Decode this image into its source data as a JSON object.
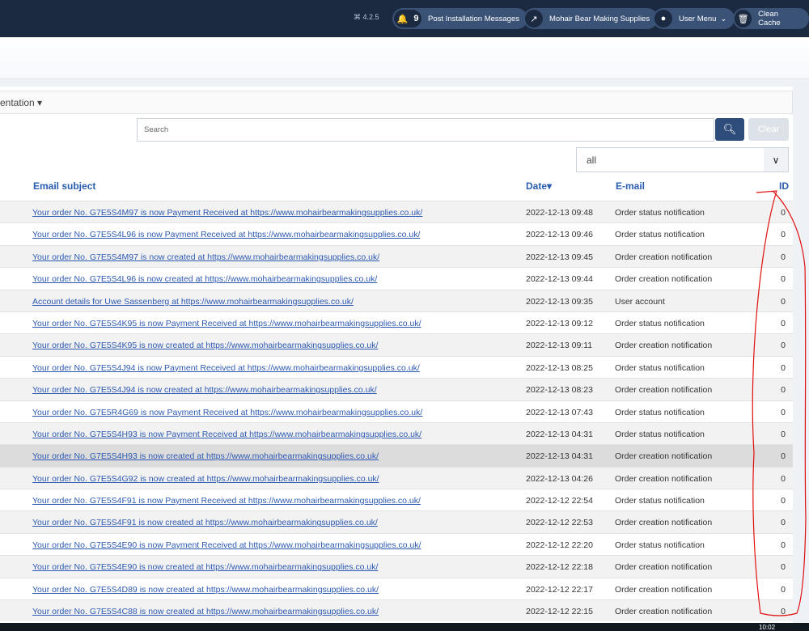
{
  "header": {
    "version": "4.2.5",
    "notifications_count": "9",
    "post_install": "Post Installation Messages",
    "site": "Mohair Bear Making Supplies",
    "user_menu": "User Menu",
    "clean_cache": "Clean Cache"
  },
  "toolbar": {
    "partial_label": "entation ▾"
  },
  "search": {
    "placeholder": "Search",
    "clear": "Clear"
  },
  "filter": {
    "value": "all"
  },
  "table": {
    "columns": {
      "subject": "Email subject",
      "date": "Date▾",
      "email": "E-mail",
      "id": "ID"
    },
    "rows": [
      {
        "subject": "Your order No. G7E5S4M97 is now Payment Received at https://www.mohairbearmakingsupplies.co.uk/",
        "date": "2022-12-13 09:48",
        "email": "Order status notification",
        "id": "0"
      },
      {
        "subject": "Your order No. G7E5S4L96 is now Payment Received at https://www.mohairbearmakingsupplies.co.uk/",
        "date": "2022-12-13 09:46",
        "email": "Order status notification",
        "id": "0"
      },
      {
        "subject": "Your order No. G7E5S4M97 is now created at https://www.mohairbearmakingsupplies.co.uk/",
        "date": "2022-12-13 09:45",
        "email": "Order creation notification",
        "id": "0"
      },
      {
        "subject": "Your order No. G7E5S4L96 is now created at https://www.mohairbearmakingsupplies.co.uk/",
        "date": "2022-12-13 09:44",
        "email": "Order creation notification",
        "id": "0"
      },
      {
        "subject": "Account details for Uwe Sassenberg at https://www.mohairbearmakingsupplies.co.uk/",
        "date": "2022-12-13 09:35",
        "email": "User account",
        "id": "0"
      },
      {
        "subject": "Your order No. G7E5S4K95 is now Payment Received at https://www.mohairbearmakingsupplies.co.uk/",
        "date": "2022-12-13 09:12",
        "email": "Order status notification",
        "id": "0"
      },
      {
        "subject": "Your order No. G7E5S4K95 is now created at https://www.mohairbearmakingsupplies.co.uk/",
        "date": "2022-12-13 09:11",
        "email": "Order creation notification",
        "id": "0"
      },
      {
        "subject": "Your order No. G7E5S4J94 is now Payment Received at https://www.mohairbearmakingsupplies.co.uk/",
        "date": "2022-12-13 08:25",
        "email": "Order status notification",
        "id": "0"
      },
      {
        "subject": "Your order No. G7E5S4J94 is now created at https://www.mohairbearmakingsupplies.co.uk/",
        "date": "2022-12-13 08:23",
        "email": "Order creation notification",
        "id": "0"
      },
      {
        "subject": "Your order No. G7E5R4G69 is now Payment Received at https://www.mohairbearmakingsupplies.co.uk/",
        "date": "2022-12-13 07:43",
        "email": "Order status notification",
        "id": "0"
      },
      {
        "subject": "Your order No. G7E5S4H93 is now Payment Received at https://www.mohairbearmakingsupplies.co.uk/",
        "date": "2022-12-13 04:31",
        "email": "Order status notification",
        "id": "0"
      },
      {
        "subject": "Your order No. G7E5S4H93 is now created at https://www.mohairbearmakingsupplies.co.uk/",
        "date": "2022-12-13 04:31",
        "email": "Order creation notification",
        "id": "0"
      },
      {
        "subject": "Your order No. G7E5S4G92 is now created at https://www.mohairbearmakingsupplies.co.uk/",
        "date": "2022-12-13 04:26",
        "email": "Order creation notification",
        "id": "0"
      },
      {
        "subject": "Your order No. G7E5S4F91 is now Payment Received at https://www.mohairbearmakingsupplies.co.uk/",
        "date": "2022-12-12 22:54",
        "email": "Order status notification",
        "id": "0"
      },
      {
        "subject": "Your order No. G7E5S4F91 is now created at https://www.mohairbearmakingsupplies.co.uk/",
        "date": "2022-12-12 22:53",
        "email": "Order creation notification",
        "id": "0"
      },
      {
        "subject": "Your order No. G7E5S4E90 is now Payment Received at https://www.mohairbearmakingsupplies.co.uk/",
        "date": "2022-12-12 22:20",
        "email": "Order status notification",
        "id": "0"
      },
      {
        "subject": "Your order No. G7E5S4E90 is now created at https://www.mohairbearmakingsupplies.co.uk/",
        "date": "2022-12-12 22:18",
        "email": "Order creation notification",
        "id": "0"
      },
      {
        "subject": "Your order No. G7E5S4D89 is now created at https://www.mohairbearmakingsupplies.co.uk/",
        "date": "2022-12-12 22:17",
        "email": "Order creation notification",
        "id": "0"
      },
      {
        "subject": "Your order No. G7E5S4C88 is now created at https://www.mohairbearmakingsupplies.co.uk/",
        "date": "2022-12-12 22:15",
        "email": "Order creation notification",
        "id": "0"
      }
    ]
  },
  "taskbar": {
    "clock": "10:02"
  }
}
